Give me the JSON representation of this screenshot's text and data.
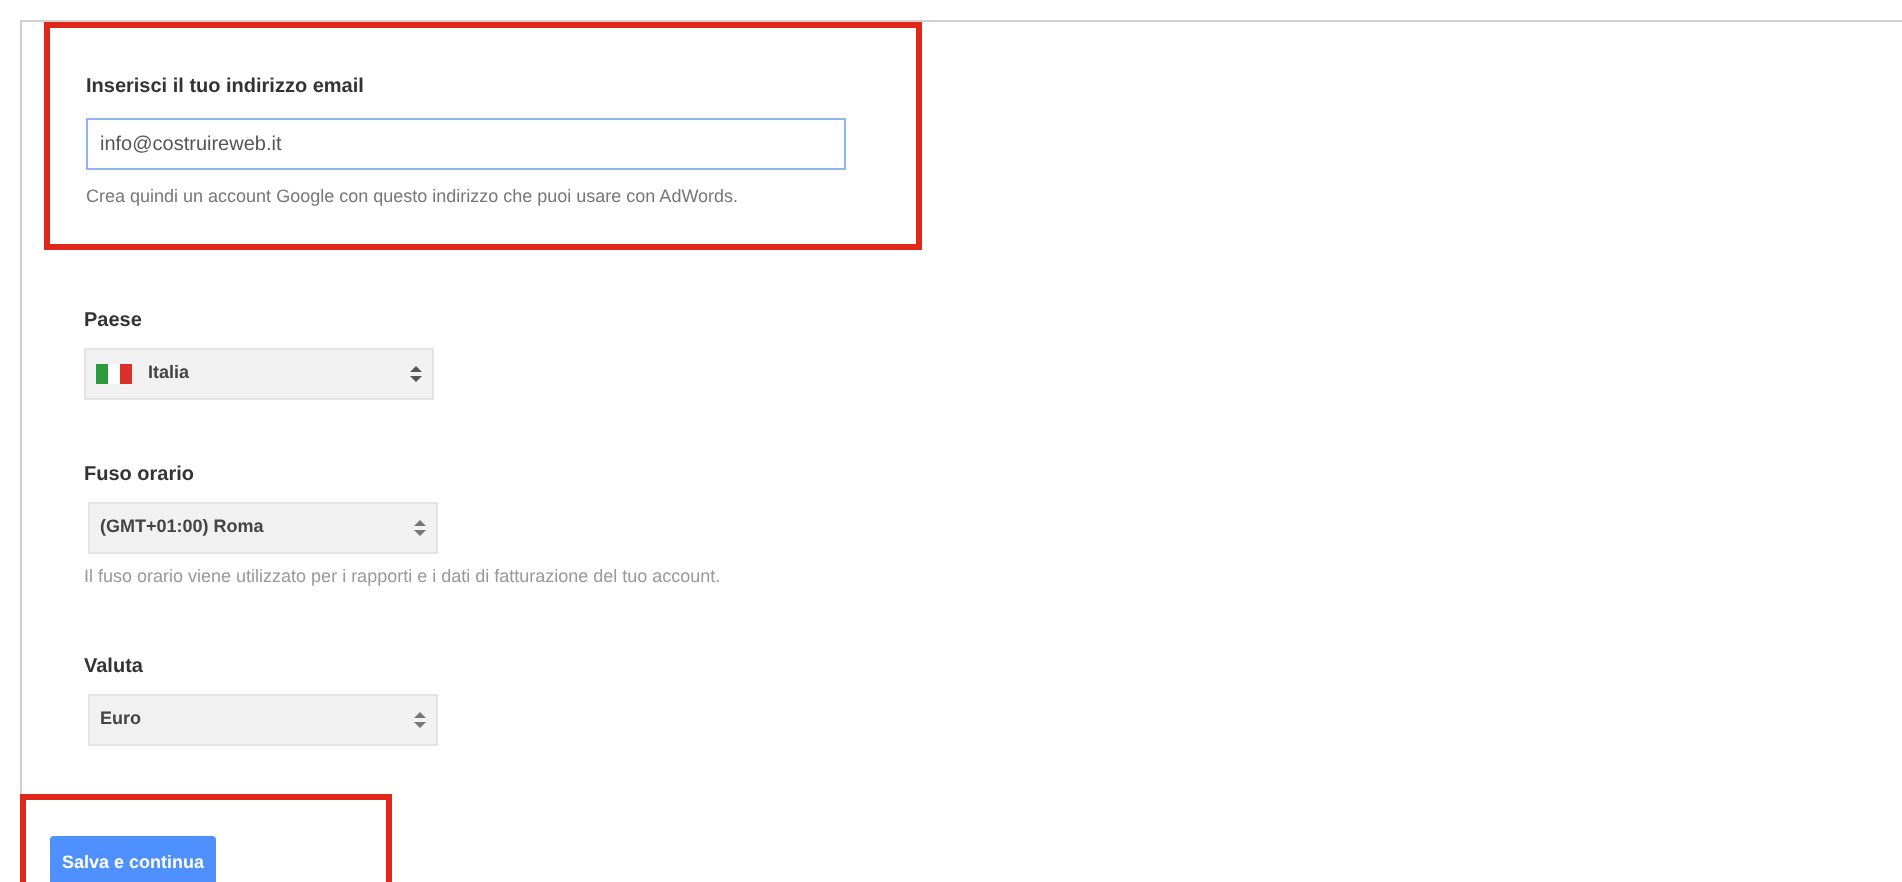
{
  "email_section": {
    "label": "Inserisci il tuo indirizzo email",
    "value": "info@costruireweb.it",
    "help": "Crea quindi un account Google con questo indirizzo che puoi usare con AdWords."
  },
  "country": {
    "label": "Paese",
    "value": "Italia"
  },
  "timezone": {
    "label": "Fuso orario",
    "value": "(GMT+01:00) Roma",
    "help": "Il fuso orario viene utilizzato per i rapporti e i dati di fatturazione del tuo account."
  },
  "currency": {
    "label": "Valuta",
    "value": "Euro"
  },
  "submit_button": {
    "label": "Salva e continua"
  }
}
